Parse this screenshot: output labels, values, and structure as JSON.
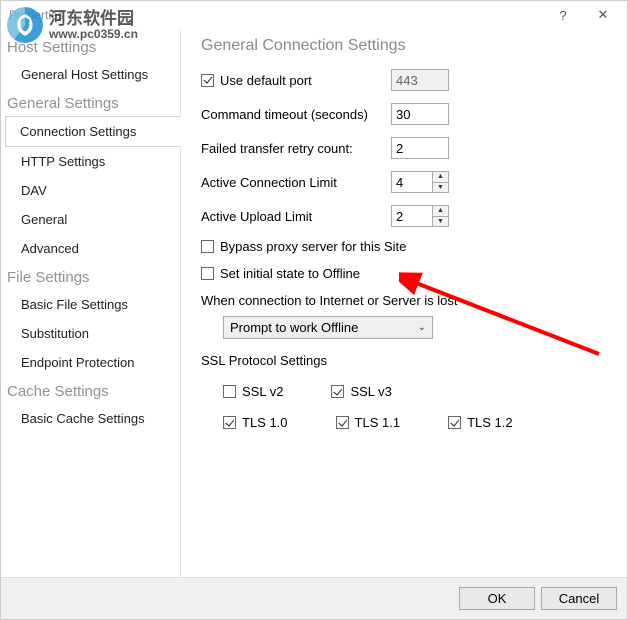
{
  "window": {
    "title": "Properties -"
  },
  "watermark": {
    "cn": "河东软件园",
    "url": "www.pc0359.cn"
  },
  "sidebar": {
    "groups": [
      {
        "title": "Host Settings",
        "items": [
          {
            "label": "General Host Settings"
          }
        ]
      },
      {
        "title": "General Settings",
        "items": [
          {
            "label": "Connection Settings",
            "active": true
          },
          {
            "label": "HTTP Settings"
          },
          {
            "label": "DAV"
          },
          {
            "label": "General"
          },
          {
            "label": "Advanced"
          }
        ]
      },
      {
        "title": "File Settings",
        "items": [
          {
            "label": "Basic File Settings"
          },
          {
            "label": "Substitution"
          },
          {
            "label": "Endpoint Protection"
          }
        ]
      },
      {
        "title": "Cache Settings",
        "items": [
          {
            "label": "Basic Cache Settings"
          }
        ]
      }
    ]
  },
  "content": {
    "title": "General Connection Settings",
    "use_default_port": {
      "label": "Use default port",
      "checked": true,
      "value": "443"
    },
    "command_timeout": {
      "label": "Command timeout (seconds)",
      "value": "30"
    },
    "retry_count": {
      "label": "Failed transfer retry count:",
      "value": "2"
    },
    "active_conn_limit": {
      "label": "Active Connection Limit",
      "value": "4"
    },
    "active_upload_limit": {
      "label": "Active Upload Limit",
      "value": "2"
    },
    "bypass_proxy": {
      "label": "Bypass proxy server for this Site",
      "checked": false
    },
    "offline_initial": {
      "label": "Set initial state to Offline",
      "checked": false
    },
    "when_lost_label": "When connection to Internet or Server is lost",
    "when_lost_value": "Prompt to work Offline",
    "ssl_title": "SSL Protocol Settings",
    "ssl": {
      "ssl_v2": {
        "label": "SSL v2",
        "checked": false
      },
      "ssl_v3": {
        "label": "SSL v3",
        "checked": true
      },
      "tls10": {
        "label": "TLS 1.0",
        "checked": true
      },
      "tls11": {
        "label": "TLS 1.1",
        "checked": true
      },
      "tls12": {
        "label": "TLS 1.2",
        "checked": true
      }
    }
  },
  "footer": {
    "ok": "OK",
    "cancel": "Cancel"
  }
}
